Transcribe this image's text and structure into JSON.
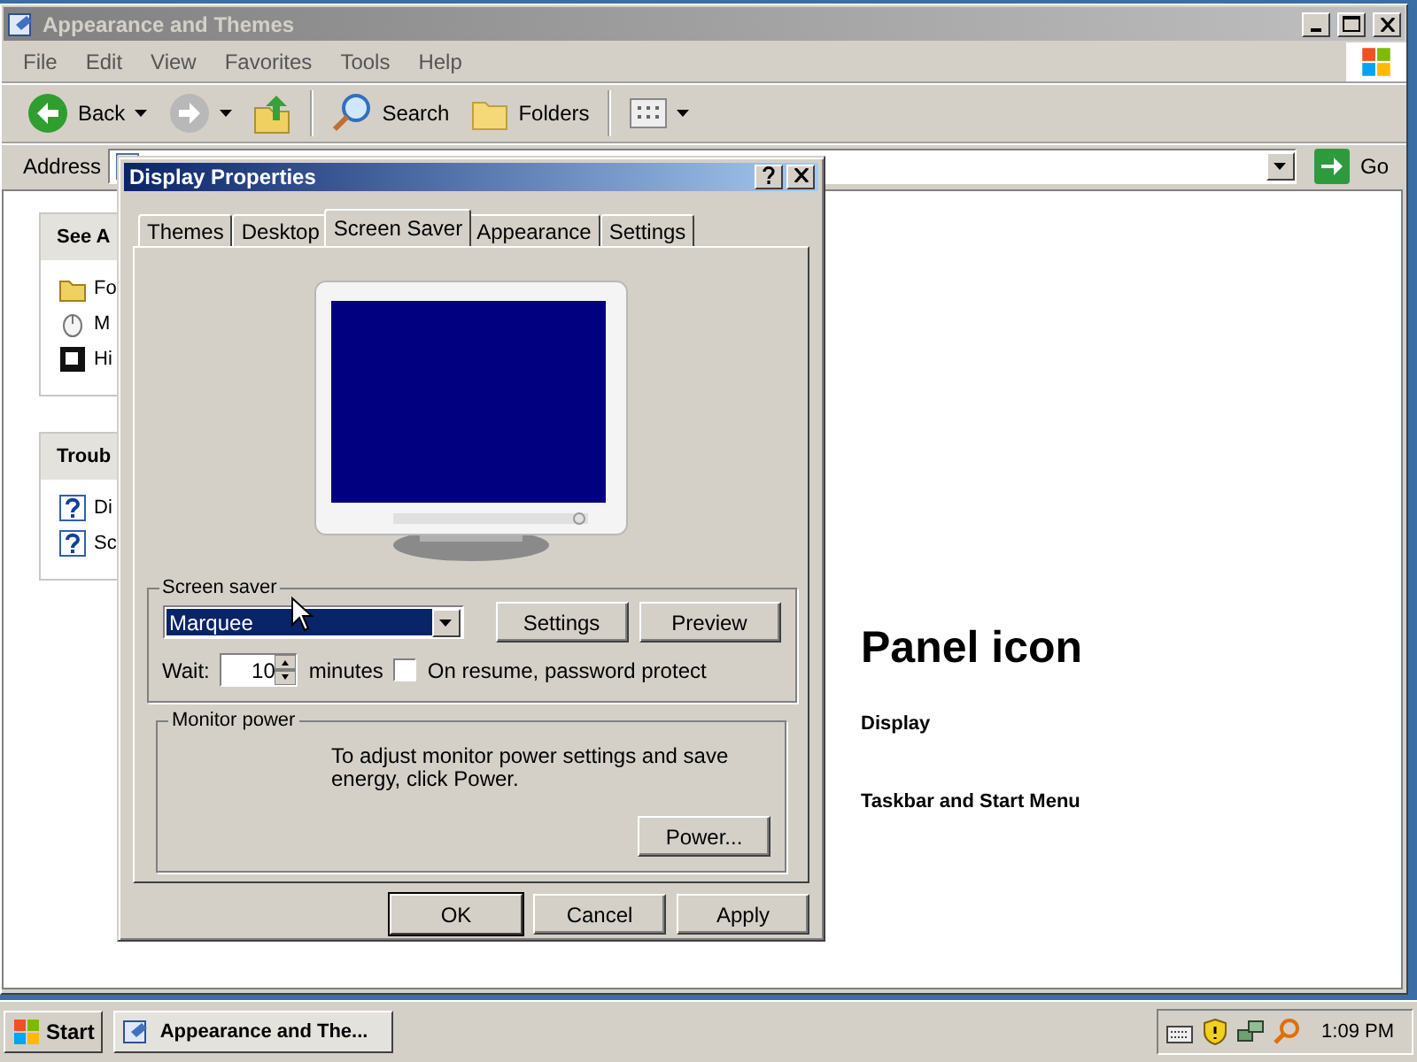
{
  "window": {
    "title": "Appearance and Themes"
  },
  "menu": [
    "File",
    "Edit",
    "View",
    "Favorites",
    "Tools",
    "Help"
  ],
  "toolbar": [
    {
      "kind": "back",
      "label": "Back"
    },
    {
      "kind": "forward"
    },
    {
      "kind": "up"
    },
    {
      "kind": "search",
      "label": "Search"
    },
    {
      "kind": "folders",
      "label": "Folders"
    },
    {
      "kind": "views"
    }
  ],
  "address": {
    "label": "Address",
    "go": "Go"
  },
  "sidebar": [
    {
      "title": "See A",
      "items": [
        {
          "kind": "folder",
          "label": "Fo"
        },
        {
          "kind": "mouse",
          "label": "M"
        },
        {
          "kind": "contrast",
          "label": "Hi"
        }
      ]
    },
    {
      "title": "Troub",
      "items": [
        {
          "kind": "help",
          "label": "Di"
        },
        {
          "kind": "help",
          "label": "Sc"
        }
      ]
    }
  ],
  "content": {
    "heading": "Panel icon",
    "links": [
      "Display",
      "Taskbar and Start Menu"
    ]
  },
  "dialog": {
    "title": "Display Properties",
    "tabs": [
      {
        "label": "Themes",
        "selected": false
      },
      {
        "label": "Desktop",
        "selected": false
      },
      {
        "label": "Screen Saver",
        "selected": true
      },
      {
        "label": "Appearance",
        "selected": false
      },
      {
        "label": "Settings",
        "selected": false
      }
    ],
    "screen_saver": {
      "legend": "Screen saver",
      "value": "Marquee",
      "settings": "Settings",
      "preview": "Preview",
      "wait_label": "Wait:",
      "wait": "10",
      "minutes": "minutes",
      "password_label": "On resume, password protect",
      "password_checked": false
    },
    "monitor_power": {
      "legend": "Monitor power",
      "text": "To adjust monitor power settings and save energy, click Power.",
      "button": "Power..."
    },
    "buttons": [
      {
        "label": "OK",
        "default": true
      },
      {
        "label": "Cancel",
        "default": false
      },
      {
        "label": "Apply",
        "default": false
      }
    ]
  },
  "taskbar": {
    "start": "Start",
    "task": "Appearance and The...",
    "clock": "1:09 PM"
  }
}
